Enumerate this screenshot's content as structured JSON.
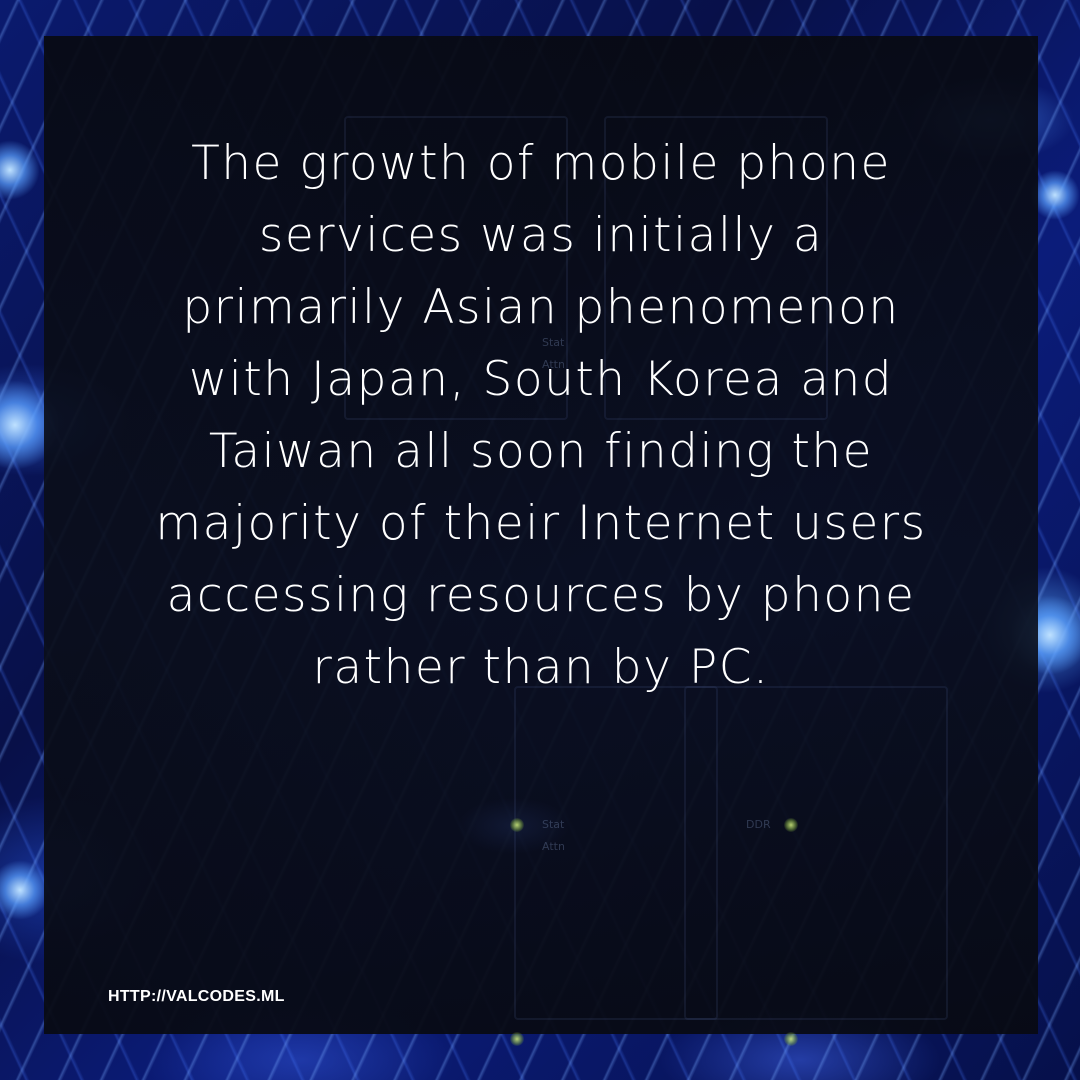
{
  "quote": {
    "lines": [
      "The growth of mobile phone",
      "services was initially a",
      "primarily Asian phenomenon",
      "with Japan, South Korea and",
      "Taiwan all soon finding the",
      "majority of their Internet users",
      "accessing resources by phone",
      "rather than by PC."
    ]
  },
  "footer": {
    "url": "HTTP://VALCODES.ML"
  },
  "background": {
    "rack_labels": [
      "Stat",
      "Attn",
      "DDR",
      "Stat",
      "Attn"
    ]
  },
  "colors": {
    "panel": "#0a0e1a",
    "text": "#ffffff",
    "background_accent": "#2a5cff"
  }
}
